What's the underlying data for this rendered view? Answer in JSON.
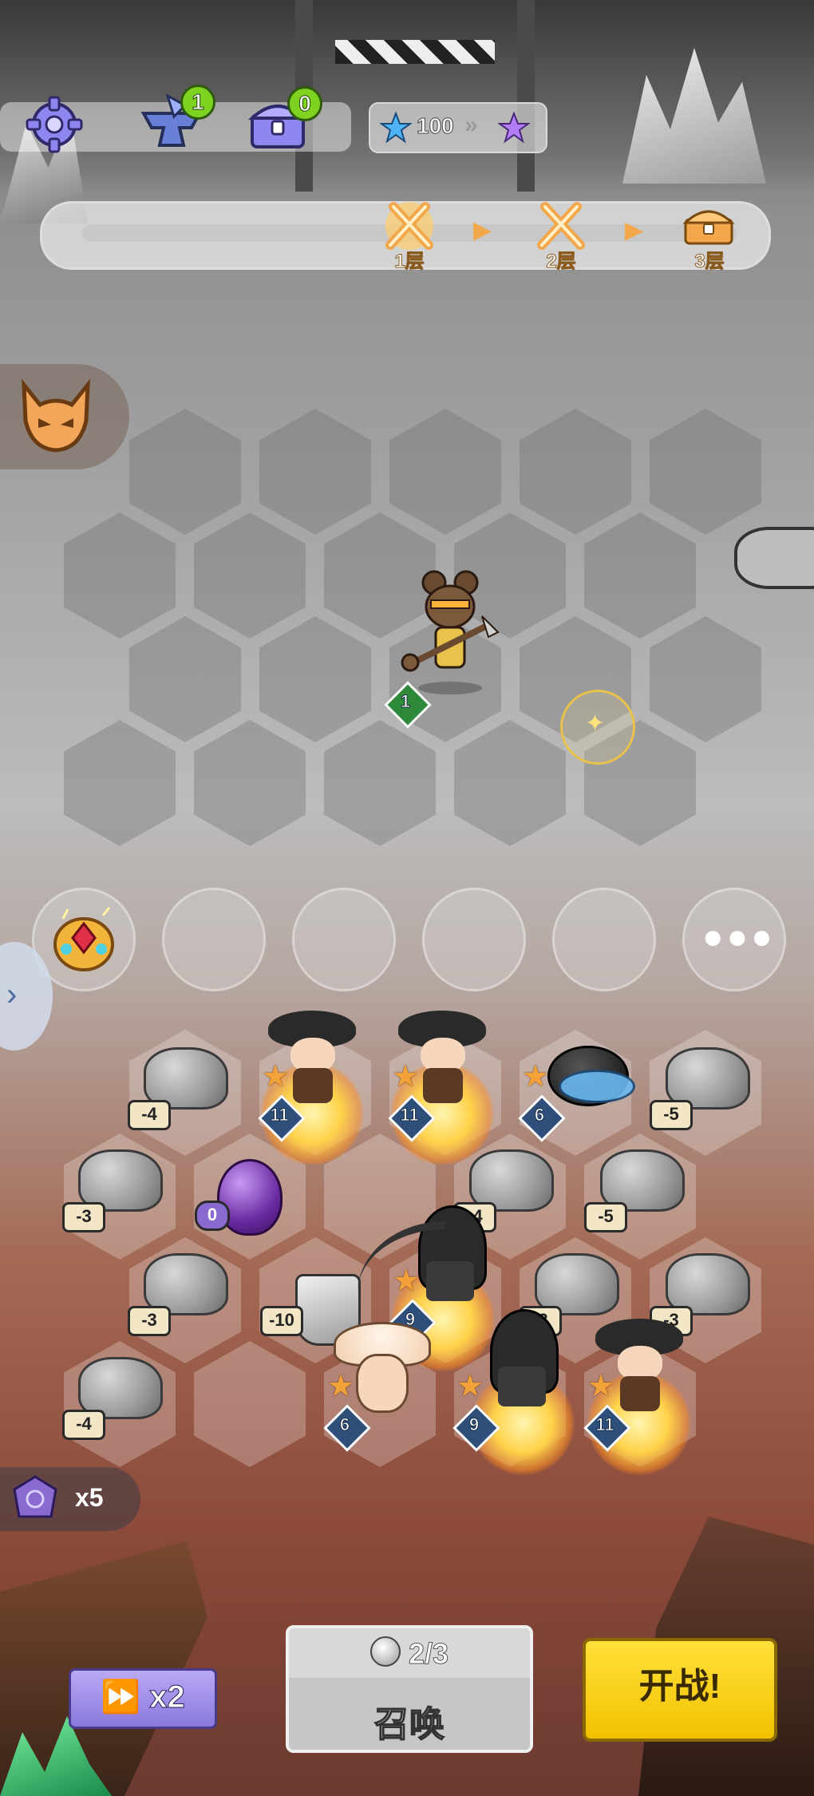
{
  "top_bar": {
    "settings_icon": "gear-icon",
    "anvil_icon": "anvil-icon",
    "anvil_badge": "1",
    "chest_icon": "treasure-chest-icon",
    "chest_badge": "0",
    "star_count": "100"
  },
  "progress": {
    "floors": [
      {
        "label": "1层",
        "icon": "crossed-swords-icon"
      },
      {
        "label": "2层",
        "icon": "crossed-swords-icon"
      },
      {
        "label": "3层",
        "icon": "treasure-chest-icon"
      }
    ]
  },
  "enemy_unit": {
    "level": "1"
  },
  "bench": {
    "item_icon": "golden-gem-pouch-icon",
    "more_icon": "more-dots-icon"
  },
  "board": {
    "rocks": [
      {
        "value": "-4"
      },
      {
        "value": "-5"
      },
      {
        "value": "-3"
      },
      {
        "value": "-4"
      },
      {
        "value": "-5"
      },
      {
        "value": "-3"
      },
      {
        "value": "-3"
      },
      {
        "value": "-3"
      },
      {
        "value": "-4"
      }
    ],
    "egg_value": "0",
    "armor_value": "-10",
    "units": [
      {
        "name": "archer",
        "level": "11"
      },
      {
        "name": "archer",
        "level": "11"
      },
      {
        "name": "blue-slime",
        "level": "6"
      },
      {
        "name": "reaper",
        "level": "9"
      },
      {
        "name": "mushroom-girl",
        "level": "6"
      },
      {
        "name": "reaper",
        "level": "9"
      },
      {
        "name": "archer",
        "level": "11"
      }
    ]
  },
  "gems": {
    "count": "x5"
  },
  "controls": {
    "speed_label": "x2",
    "summon_cost": "2/3",
    "summon_label": "召唤",
    "battle_label": "开战!"
  }
}
